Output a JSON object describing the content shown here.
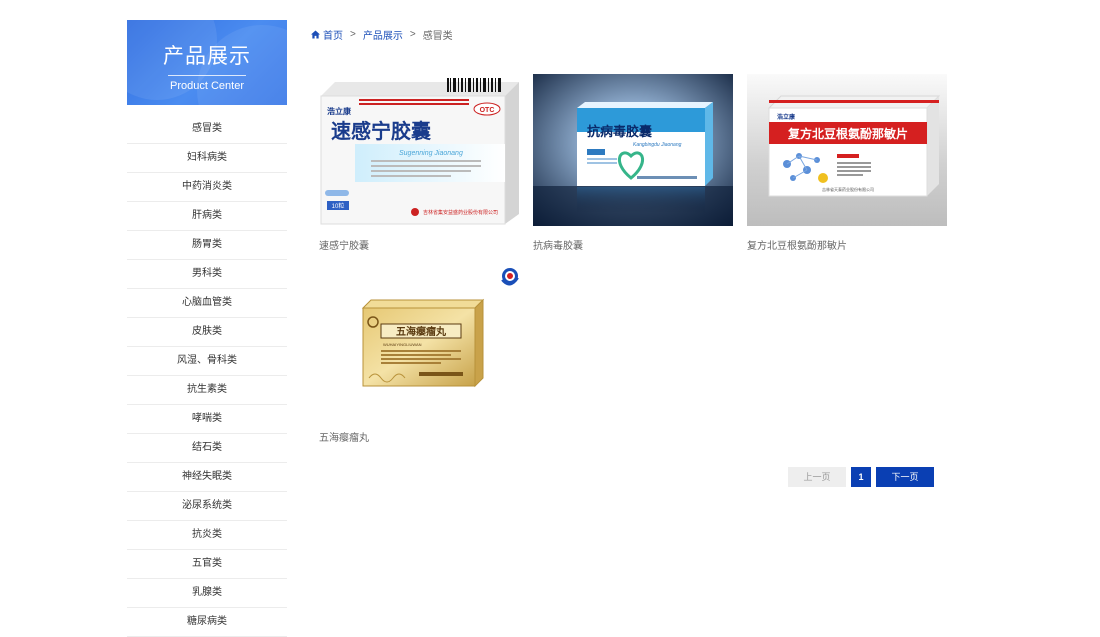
{
  "sidebar": {
    "title": "产品展示",
    "subtitle": "Product Center",
    "categories": [
      "感冒类",
      "妇科病类",
      "中药消炎类",
      "肝病类",
      "肠胃类",
      "男科类",
      "心脑血管类",
      "皮肤类",
      "风湿、骨科类",
      "抗生素类",
      "哮喘类",
      "结石类",
      "神经失眠类",
      "泌尿系统类",
      "抗炎类",
      "五官类",
      "乳腺类",
      "糖尿病类"
    ]
  },
  "breadcrumb": {
    "home": "首页",
    "section": "产品展示",
    "current": "感冒类",
    "separator": ">"
  },
  "products": [
    {
      "name": "速感宁胶囊",
      "box_title": "速感宁胶囊",
      "box_pinyin": "Sugenning Jiaonang",
      "box_badge": "OTC",
      "box_brand": "浩立康",
      "box_count": "10粒",
      "box_maker": "吉林省集安益盛药业股份有限公司"
    },
    {
      "name": "抗病毒胶囊",
      "box_title": "抗病毒胶囊",
      "box_pinyin": "Kangbingdu Jiaonang"
    },
    {
      "name": "复方北豆根氨酚那敏片",
      "box_title": "复方北豆根氨酚那敏片",
      "box_brand": "浩立康",
      "box_maker": "吉林省天泰药业股份有限公司"
    },
    {
      "name": "五海瘿瘤丸",
      "box_title": "五海瘿瘤丸",
      "box_pinyin": "WUHAIYINGLIUWAN"
    }
  ],
  "pagination": {
    "prev": "上一页",
    "current": "1",
    "next": "下一页"
  },
  "colors": {
    "accent": "#0a3fb3",
    "banner": "#3d7ae8"
  }
}
